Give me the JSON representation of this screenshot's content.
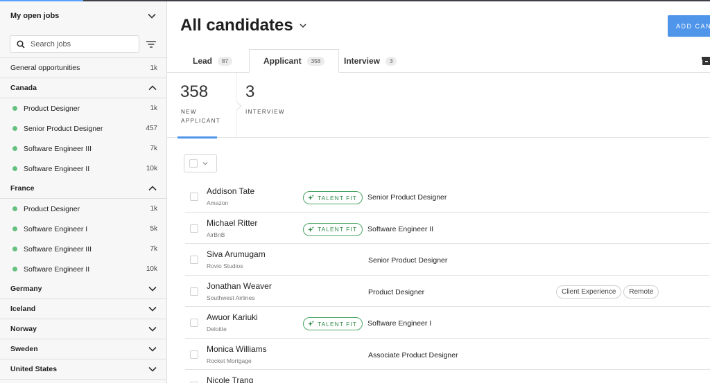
{
  "sidebar": {
    "title": "My open jobs",
    "search_placeholder": "Search jobs",
    "general": {
      "label": "General opportunities",
      "count": "1k"
    },
    "groups": [
      {
        "country": "Canada",
        "expanded": true,
        "jobs": [
          {
            "title": "Product Designer",
            "count": "1k"
          },
          {
            "title": "Senior Product Designer",
            "count": "457"
          },
          {
            "title": "Software Engineer III",
            "count": "7k"
          },
          {
            "title": "Software Engineer II",
            "count": "10k"
          }
        ]
      },
      {
        "country": "France",
        "expanded": true,
        "jobs": [
          {
            "title": "Product Designer",
            "count": "1k"
          },
          {
            "title": "Software Engineer I",
            "count": "5k"
          },
          {
            "title": "Software Engineer III",
            "count": "7k"
          },
          {
            "title": "Software Engineer II",
            "count": "10k"
          }
        ]
      },
      {
        "country": "Germany",
        "expanded": false
      },
      {
        "country": "Iceland",
        "expanded": false
      },
      {
        "country": "Norway",
        "expanded": false
      },
      {
        "country": "Sweden",
        "expanded": false
      },
      {
        "country": "United States",
        "expanded": false
      }
    ],
    "dot_color": "#66c07e"
  },
  "header": {
    "title": "All candidates",
    "add_button": "ADD CANDIDATE"
  },
  "tabs": [
    {
      "label": "Lead",
      "count": "87"
    },
    {
      "label": "Applicant",
      "count": "358",
      "active": true
    },
    {
      "label": "Interview",
      "count": "3"
    }
  ],
  "stages": [
    {
      "count": "358",
      "label": "NEW APPLICANT",
      "active": true
    },
    {
      "count": "3",
      "label": "INTERVIEW"
    }
  ],
  "talent_fit_label": "TALENT FIT",
  "candidates": [
    {
      "name": "Addison Tate",
      "company": "Amazon",
      "talent_fit": true,
      "job": "Senior Product Designer",
      "tags": []
    },
    {
      "name": "Michael Ritter",
      "company": "AirBnB",
      "talent_fit": true,
      "job": "Software Engineer II",
      "tags": []
    },
    {
      "name": "Siva Arumugam",
      "company": "Rovio Studios",
      "talent_fit": false,
      "job": "Senior Product Designer",
      "tags": []
    },
    {
      "name": "Jonathan Weaver",
      "company": "Southwest Airlines",
      "talent_fit": false,
      "job": "Product Designer",
      "tags": [
        "Client Experience",
        "Remote"
      ]
    },
    {
      "name": "Awuor Kariuki",
      "company": "Deloitte",
      "talent_fit": true,
      "job": "Software Engineer I",
      "tags": []
    },
    {
      "name": "Monica Williams",
      "company": "Rocket Mortgage",
      "talent_fit": false,
      "job": "Associate Product Designer",
      "tags": []
    },
    {
      "name": "Nicole Trang",
      "company": "",
      "talent_fit": false,
      "job": "",
      "tags": []
    }
  ],
  "colors": {
    "accent": "#4f95ea",
    "talent_fit": "#4aa564"
  }
}
